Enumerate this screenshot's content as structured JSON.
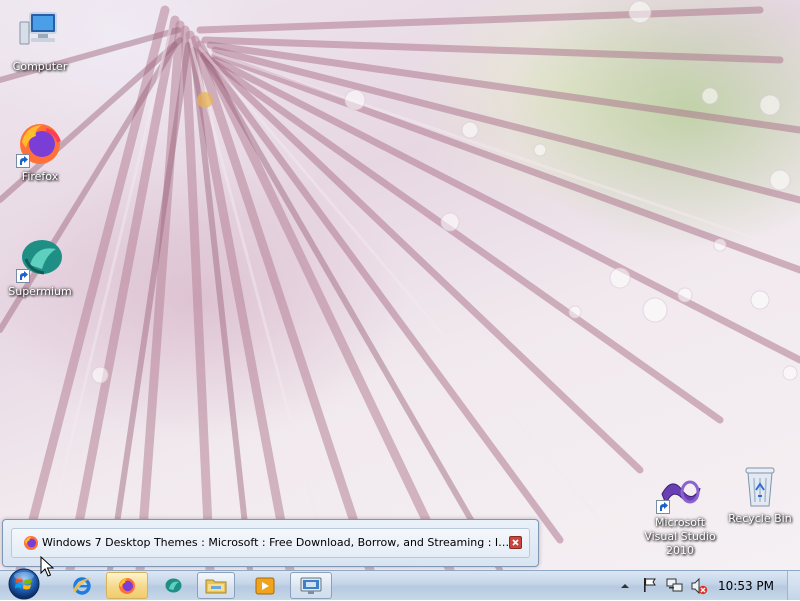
{
  "desktop": {
    "icons": [
      {
        "label": "Computer",
        "icon": "computer-icon",
        "shortcut": false
      },
      {
        "label": "Firefox",
        "icon": "firefox-icon",
        "shortcut": true
      },
      {
        "label": "Supermium",
        "icon": "supermium-icon",
        "shortcut": true
      },
      {
        "label": "Microsoft Visual Studio 2010",
        "icon": "visual-studio-icon",
        "shortcut": true
      },
      {
        "label": "Recycle Bin",
        "icon": "recycle-bin-icon",
        "shortcut": false
      }
    ]
  },
  "thumbnail_preview": {
    "title": "Windows 7 Desktop Themes : Microsoft : Free Download, Borrow, and Streaming : Inter...",
    "icon": "firefox-icon",
    "close_icon": "close-icon"
  },
  "taskbar": {
    "start_icon": "windows-orb-icon",
    "buttons": [
      {
        "name": "internet-explorer",
        "icon": "internet-explorer-icon",
        "state": "pinned"
      },
      {
        "name": "firefox",
        "icon": "firefox-icon",
        "state": "active"
      },
      {
        "name": "supermium",
        "icon": "supermium-icon",
        "state": "pinned"
      },
      {
        "name": "file-explorer",
        "icon": "folder-icon",
        "state": "running"
      },
      {
        "name": "media-player",
        "icon": "media-player-icon",
        "state": "pinned"
      },
      {
        "name": "remote-desktop",
        "icon": "remote-desktop-icon",
        "state": "running"
      }
    ],
    "tray": {
      "icons": [
        "show-hidden-icons-icon",
        "action-center-flag-icon",
        "network-icon",
        "volume-muted-icon"
      ],
      "clock": "10:53 PM"
    }
  },
  "colors": {
    "taskbar": "#c3d4e8",
    "active_button": "#f5d88a",
    "icon_label": "#ffffff"
  }
}
